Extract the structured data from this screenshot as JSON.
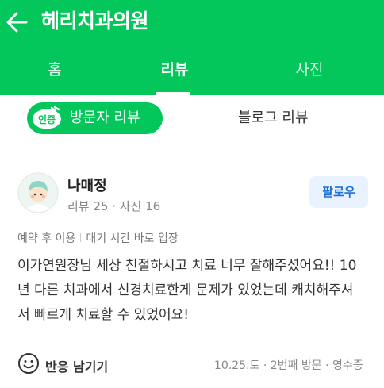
{
  "header": {
    "title": "헤리치과의원"
  },
  "tabs": [
    {
      "label": "홈"
    },
    {
      "label": "리뷰"
    },
    {
      "label": "사진"
    }
  ],
  "review_filter": {
    "visit_badge": "인증",
    "visit_label": "방문자 리뷰",
    "blog_label": "블로그 리뷰"
  },
  "review": {
    "author": "나매정",
    "stats": "리뷰 25 · 사진 16",
    "follow_label": "팔로우",
    "tags": [
      "예약 후 이용",
      "대기 시간 바로 입장"
    ],
    "text_lines": [
      "이가연원장님 세상 친절하시고 치료 너무 잘해주셨어요!! 10",
      "년 다른 치과에서 신경치료한게 문제가 있었는데 캐치해주셔",
      "서 빠르게 치료할 수 있었어요!"
    ],
    "reaction_label": "반응 남기기",
    "footer_meta": "10.25.토 · 2번째 방문 · 영수증"
  },
  "colors": {
    "brand_green": "#03c75a",
    "follow_bg": "#e8f3ff",
    "follow_text": "#1e6fd9"
  },
  "icons": {
    "back": "arrow-left-icon",
    "badge": "verified-badge-icon",
    "avatar": "user-avatar",
    "reaction": "smile-icon"
  }
}
